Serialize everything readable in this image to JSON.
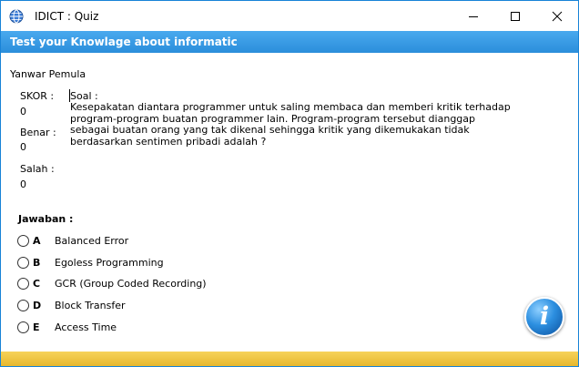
{
  "window": {
    "title": "IDICT : Quiz",
    "minimize_icon": "minimize-icon",
    "maximize_icon": "maximize-icon",
    "close_icon": "close-icon"
  },
  "header": {
    "text": "Test your Knowlage about informatic",
    "color": "#2b8edb"
  },
  "user": {
    "name": "Yanwar Pemula"
  },
  "stats": {
    "skor_label": "SKOR :",
    "skor_value": "0",
    "benar_label": "Benar :",
    "benar_value": "0",
    "salah_label": "Salah  :",
    "salah_value": "0"
  },
  "question": {
    "label": "Soal :",
    "text": "Kesepakatan diantara programmer untuk saling membaca dan memberi kritik terhadap\nprogram-program buatan programmer lain. Program-program tersebut dianggap\nsebagai buatan orang yang tak dikenal sehingga kritik yang dikemukakan tidak\nberdasarkan sentimen pribadi adalah ?"
  },
  "answers": {
    "heading": "Jawaban  :",
    "options": [
      {
        "letter": "A",
        "text": "Balanced Error"
      },
      {
        "letter": "B",
        "text": "Egoless Programming"
      },
      {
        "letter": "C",
        "text": "GCR (Group Coded Recording)"
      },
      {
        "letter": "D",
        "text": "Block Transfer"
      },
      {
        "letter": "E",
        "text": "Access Time"
      }
    ]
  },
  "info_button": {
    "icon": "info-icon",
    "glyph": "i"
  },
  "footer": {
    "color": "#e6b62a"
  }
}
